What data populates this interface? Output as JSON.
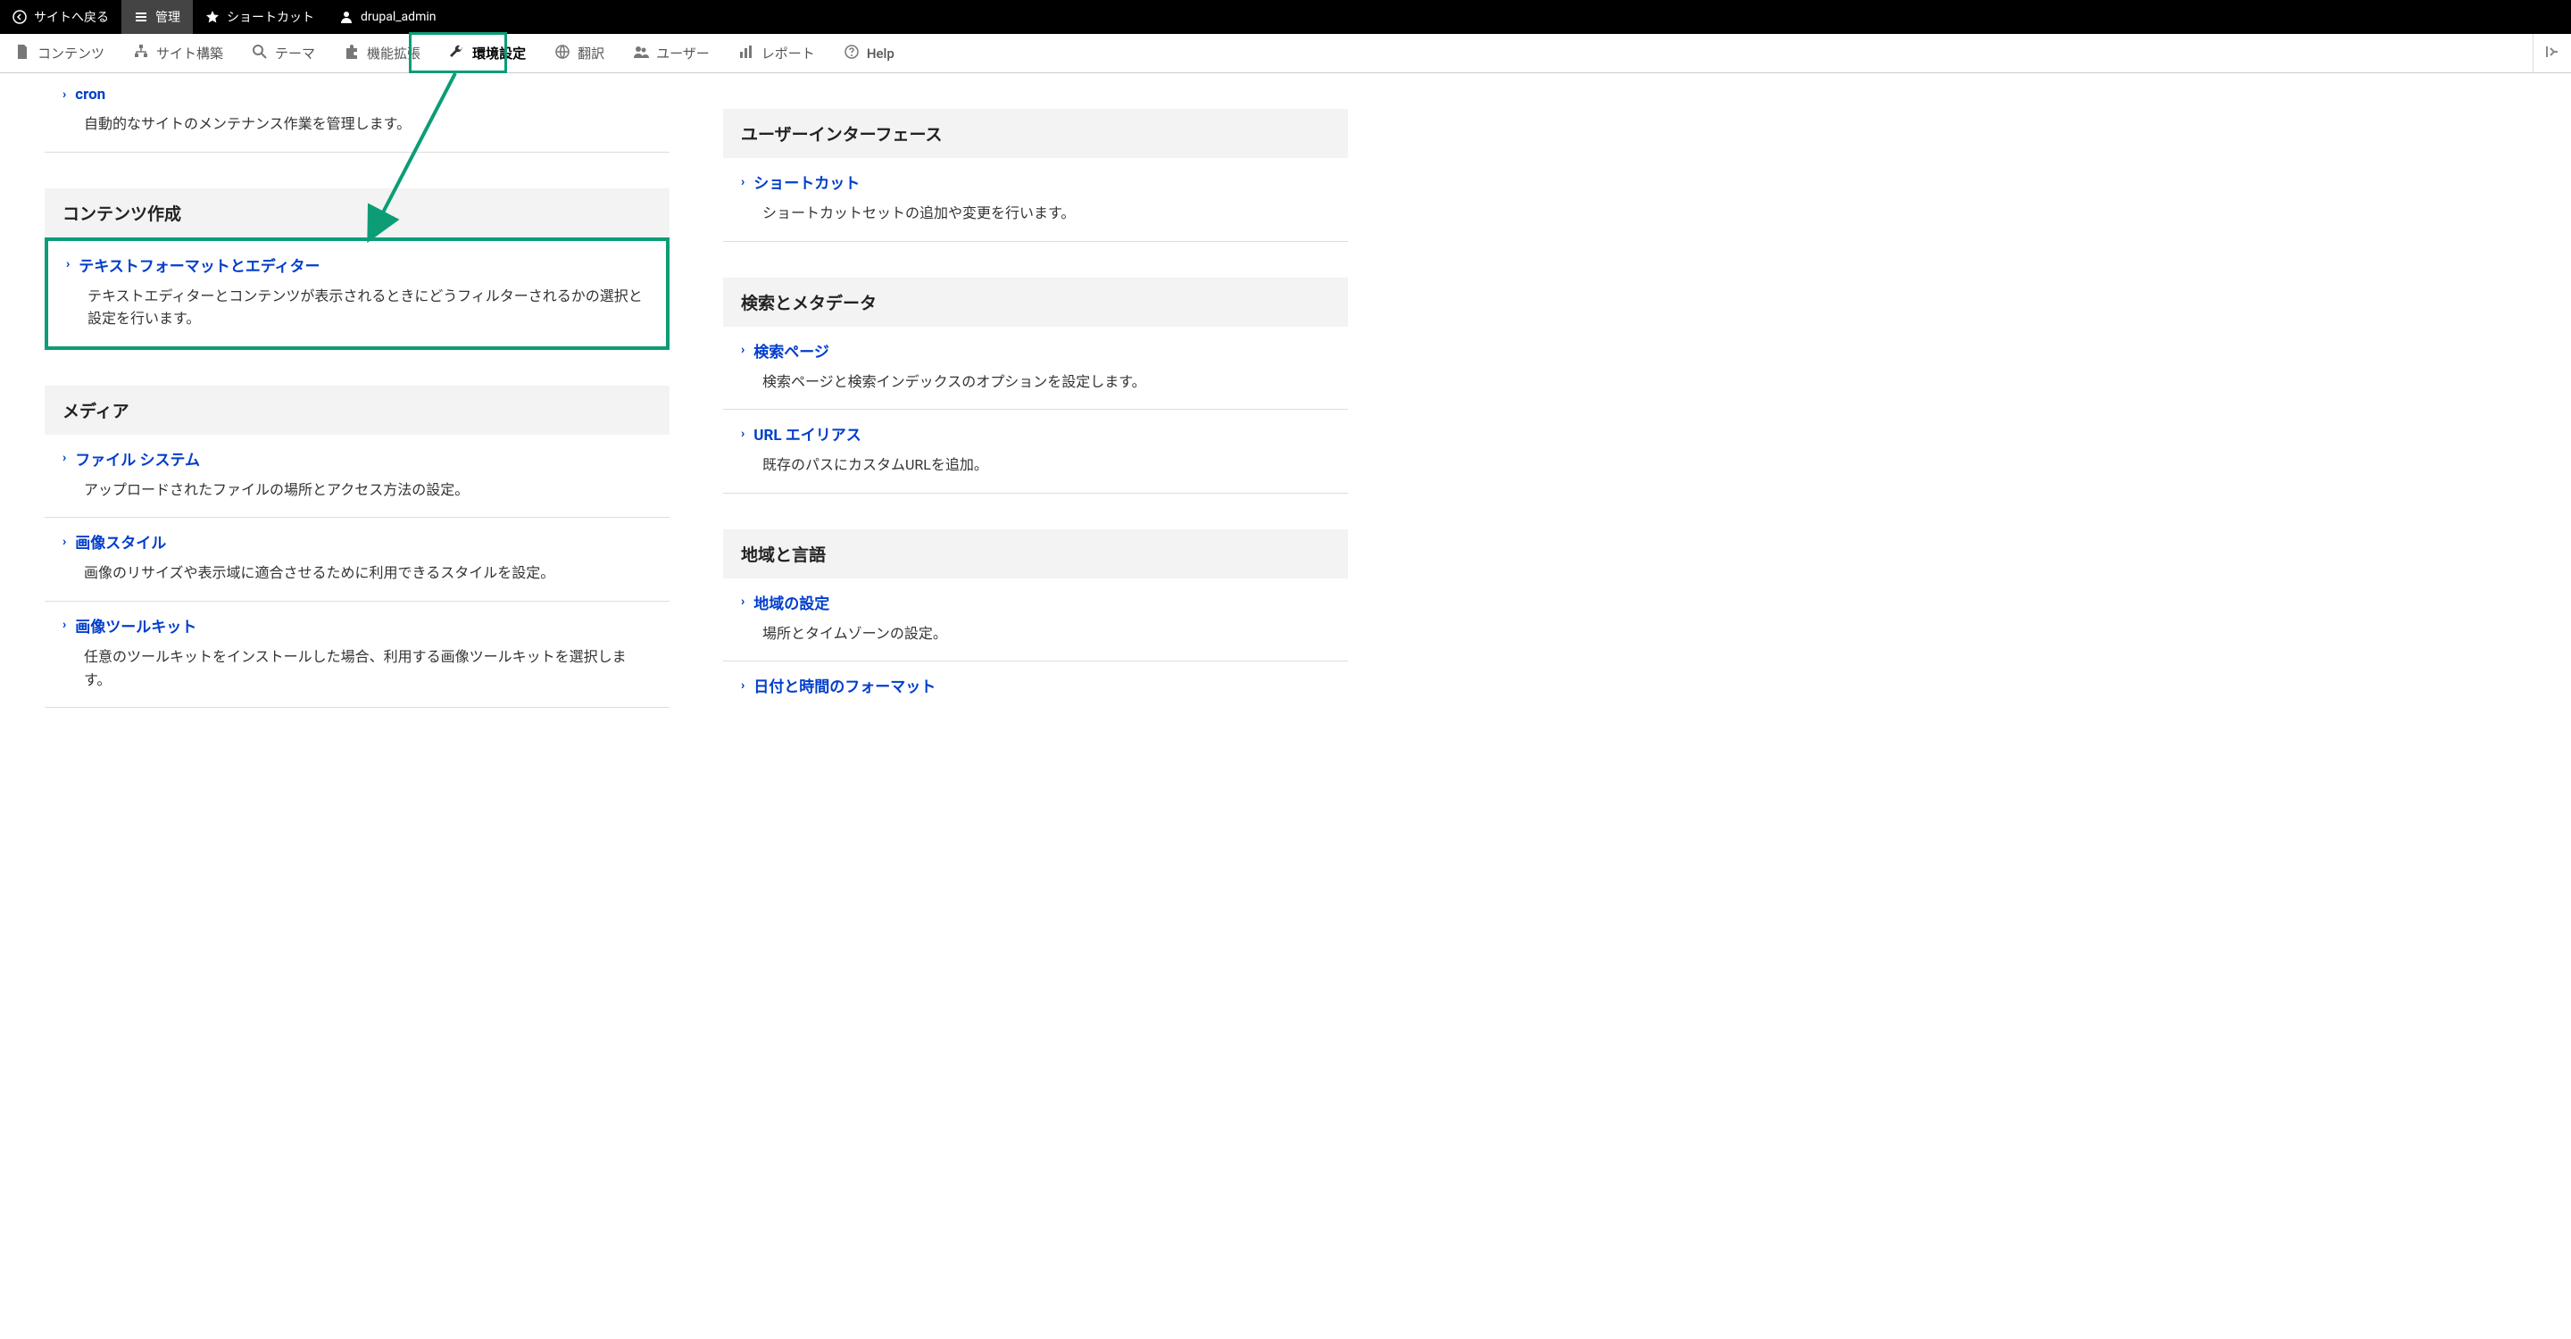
{
  "topbar": {
    "back": "サイトへ戻る",
    "manage": "管理",
    "shortcuts": "ショートカット",
    "user": "drupal_admin"
  },
  "toolbar": {
    "content": "コンテンツ",
    "structure": "サイト構築",
    "theme": "テーマ",
    "extend": "機能拡張",
    "config": "環境設定",
    "translate": "翻訳",
    "users": "ユーザー",
    "reports": "レポート",
    "help": "Help"
  },
  "left": {
    "cron": {
      "title": "cron",
      "desc": "自動的なサイトのメンテナンス作業を管理します。"
    },
    "section_content": "コンテンツ作成",
    "textformat": {
      "title": "テキストフォーマットとエディター",
      "desc": "テキストエディターとコンテンツが表示されるときにどうフィルターされるかの選択と設定を行います。"
    },
    "section_media": "メディア",
    "filesystem": {
      "title": "ファイル システム",
      "desc": "アップロードされたファイルの場所とアクセス方法の設定。"
    },
    "imgstyle": {
      "title": "画像スタイル",
      "desc": "画像のリサイズや表示域に適合させるために利用できるスタイルを設定。"
    },
    "imgtoolkit": {
      "title": "画像ツールキット",
      "desc": "任意のツールキットをインストールした場合、利用する画像ツールキットを選択します。"
    }
  },
  "right": {
    "section_ui": "ユーザーインターフェース",
    "shortcut": {
      "title": "ショートカット",
      "desc": "ショートカットセットの追加や変更を行います。"
    },
    "section_search": "検索とメタデータ",
    "searchpage": {
      "title": "検索ページ",
      "desc": "検索ページと検索インデックスのオプションを設定します。"
    },
    "urlalias": {
      "title": "URL エイリアス",
      "desc": "既存のパスにカスタムURLを追加。"
    },
    "section_region": "地域と言語",
    "region": {
      "title": "地域の設定",
      "desc": "場所とタイムゾーンの設定。"
    },
    "dateformat": {
      "title": "日付と時間のフォーマット"
    }
  },
  "colors": {
    "accent": "#0c9d76",
    "link": "#003ecc"
  }
}
